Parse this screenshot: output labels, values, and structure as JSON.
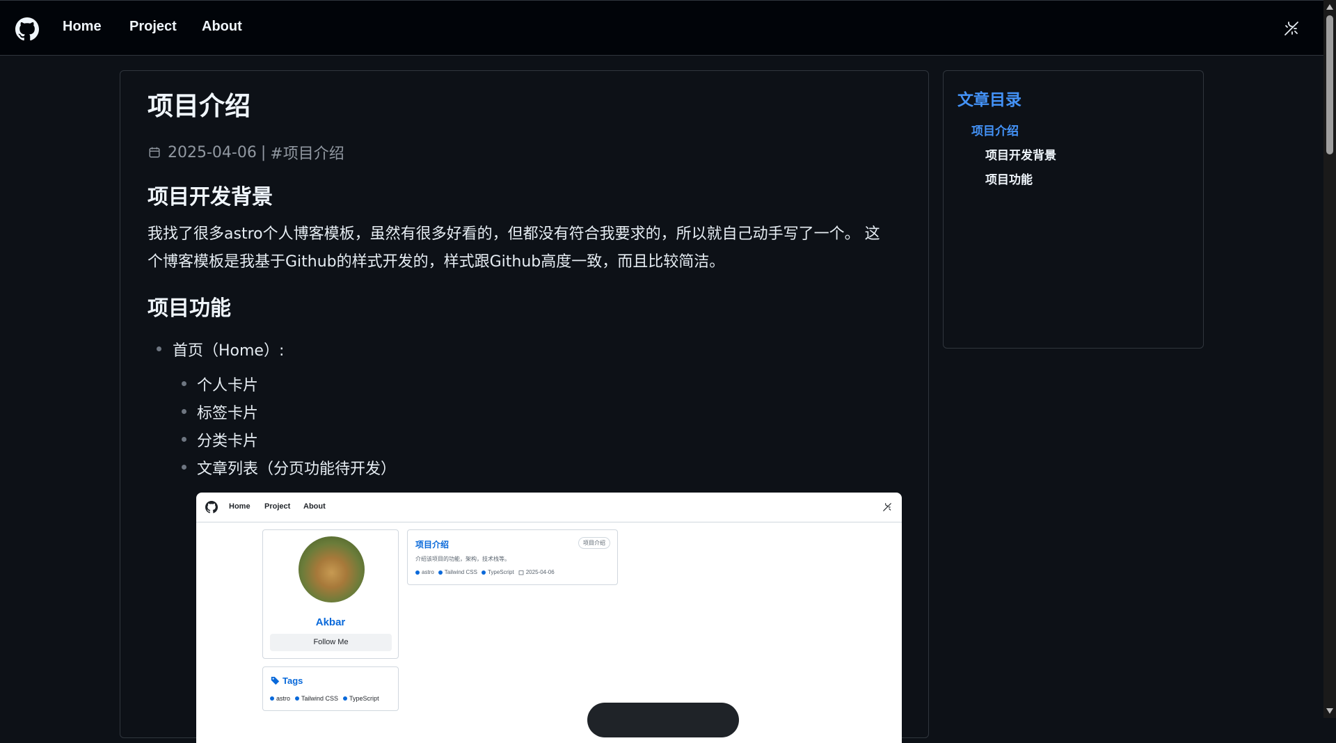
{
  "nav": {
    "links": [
      "Home",
      "Project",
      "About"
    ],
    "logo_icon": "github-icon",
    "toggle_icon": "theme-toggle-icon"
  },
  "article": {
    "title": "项目介绍",
    "date": "2025-04-06",
    "separator": "|",
    "tag": "#项目介绍",
    "section1": {
      "heading": "项目开发背景",
      "lines": [
        "我找了很多astro个人博客模板，虽然有很多好看的，但都没有符合我要求的，所以就自己动手写了一个。 这",
        "个博客模板是我基于Github的样式开发的，样式跟Github高度一致，而且比较简洁。"
      ]
    },
    "section2": {
      "heading": "项目功能",
      "item": "首页（Home）:",
      "subitems": [
        "个人卡片",
        "标签卡片",
        "分类卡片",
        "文章列表（分页功能待开发）"
      ]
    }
  },
  "screenshot": {
    "nav_links": [
      "Home",
      "Project",
      "About"
    ],
    "profile": {
      "name": "Akbar",
      "follow": "Follow Me"
    },
    "tags_card": {
      "title": "Tags",
      "tags": [
        "astro",
        "Tailwind CSS",
        "TypeScript"
      ]
    },
    "post": {
      "title": "项目介绍",
      "badge": "项目介绍",
      "desc": "介绍该项目的功能，架构，技术栈等。",
      "tags": [
        "astro",
        "Tailwind CSS",
        "TypeScript"
      ],
      "date": "2025-04-06"
    }
  },
  "toc": {
    "title": "文章目录",
    "items": [
      "项目介绍",
      "项目开发背景",
      "项目功能"
    ]
  },
  "colors": {
    "background": "#0d1117",
    "accent": "#4493f8",
    "border": "#30363d"
  }
}
